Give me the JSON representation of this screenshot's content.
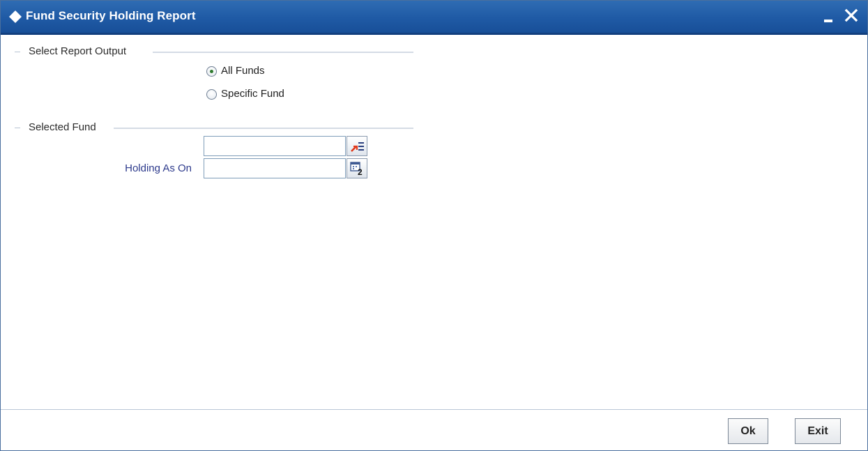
{
  "window": {
    "title": "Fund Security Holding Report",
    "minimize_icon": "minimize-icon",
    "close_icon": "close-icon",
    "title_icon": "diamond-icon"
  },
  "report_output": {
    "heading": "Select Report Output",
    "options": [
      {
        "label": "All Funds",
        "checked": true
      },
      {
        "label": "Specific Fund",
        "checked": false
      }
    ]
  },
  "selected_fund": {
    "heading": "Selected Fund",
    "fund_input": {
      "value": "",
      "placeholder": "",
      "lookup_icon": "list-lookup-icon"
    },
    "holding_as_on": {
      "label": "Holding As On",
      "value": "",
      "calendar_icon": "calendar-icon"
    }
  },
  "footer": {
    "ok_label": "Ok",
    "exit_label": "Exit"
  },
  "colors": {
    "titlebar": "#1f5aa5",
    "field_label": "#2d3a8c",
    "radio_check": "#2f7a2f"
  }
}
